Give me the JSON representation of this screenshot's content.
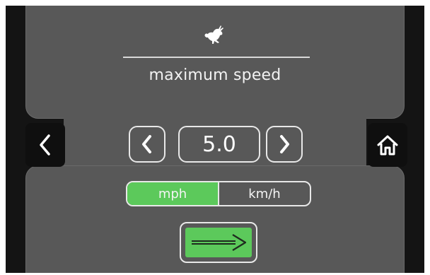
{
  "screen": {
    "title": "maximum speed",
    "icons": {
      "header": "rabbit-icon",
      "back": "chevron-left-icon",
      "home": "home-icon",
      "decrease": "chevron-left-icon",
      "increase": "chevron-right-icon",
      "confirm": "arrow-right-icon"
    }
  },
  "speed": {
    "value": "5.0"
  },
  "units": {
    "options": [
      "mph",
      "km/h"
    ],
    "selected": "mph"
  },
  "colors": {
    "accent": "#5cc95b",
    "panel": "#585858",
    "background": "#141414",
    "outline": "#e8e8e8"
  }
}
